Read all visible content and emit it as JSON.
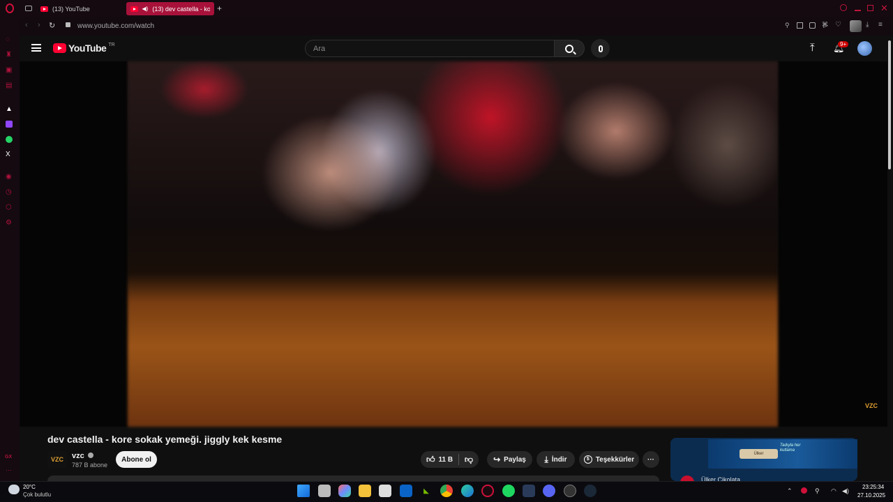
{
  "browser": {
    "tabs": [
      {
        "label": "(13) YouTube",
        "active": false
      },
      {
        "label": "(13) dev castella - kor",
        "active": true
      }
    ],
    "new_tab": "+",
    "url": "www.youtube.com/watch"
  },
  "opera_sidebar": {
    "bottom_label": "GX"
  },
  "youtube": {
    "logo_text": "YouTube",
    "logo_region": "TR",
    "search_placeholder": "Ara",
    "notification_badge": "9+"
  },
  "video": {
    "title": "dev castella - kore sokak yemeği. jiggly kek kesme",
    "watermark": "VZC",
    "channel": {
      "avatar_text": "VZC",
      "name": "vzc",
      "subscribers": "787 B abone",
      "subscribe_label": "Abone ol"
    },
    "actions": {
      "likes": "11 B",
      "share": "Paylaş",
      "download": "İndir",
      "thanks": "Teşekkürler"
    }
  },
  "ad": {
    "product": "Ülker",
    "title": "Ülker Çikolata",
    "tagline": "Tadıyla her kutlama"
  },
  "taskbar": {
    "weather_temp": "20°C",
    "weather_desc": "Çok bulutlu",
    "time": "23:25:34",
    "date": "27.10.2025"
  }
}
